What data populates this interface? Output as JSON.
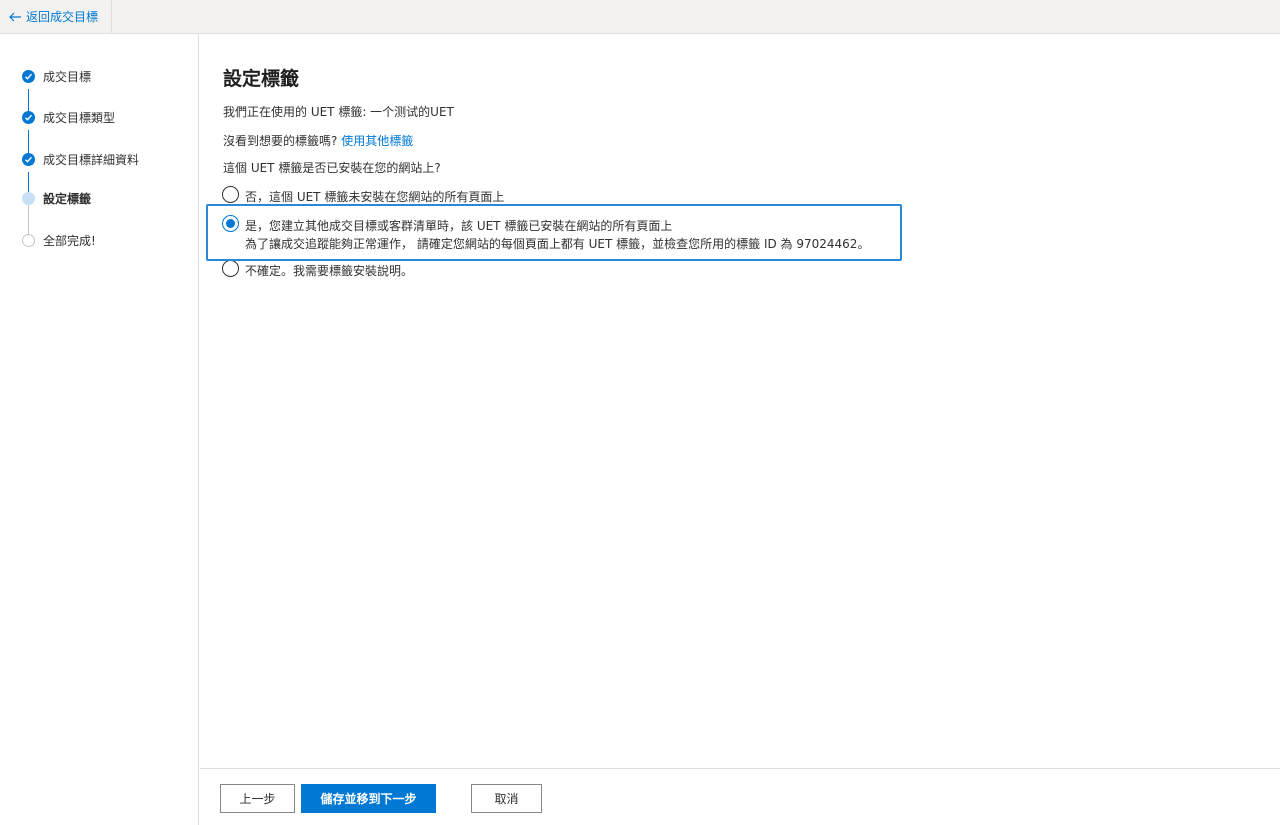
{
  "topbar": {
    "back_label": "返回成交目標"
  },
  "sidebar": {
    "steps": [
      {
        "label": "成交目標",
        "state": "done"
      },
      {
        "label": "成交目標類型",
        "state": "done"
      },
      {
        "label": "成交目標詳細資料",
        "state": "done"
      },
      {
        "label": "設定標籤",
        "state": "current"
      },
      {
        "label": "全部完成!",
        "state": "pending"
      }
    ]
  },
  "main": {
    "title": "設定標籤",
    "using_tag_text": "我們正在使用的 UET 標籤: 一个测试的UET",
    "not_found_text": "沒看到想要的標籤嗎? ",
    "use_other_tag_link": "使用其他標籤",
    "question": "這個 UET 標籤是否已安裝在您的網站上?",
    "options": [
      {
        "label": "否，這個 UET 標籤未安裝在您網站的所有頁面上",
        "selected": false
      },
      {
        "label": "是，您建立其他成交目標或客群清單時，該 UET 標籤已安裝在網站的所有頁面上",
        "sublabel": "為了讓成交追蹤能夠正常運作， 請確定您網站的每個頁面上都有 UET 標籤，並檢查您所用的標籤 ID 為 97024462。",
        "selected": true
      },
      {
        "label": "不確定。我需要標籤安裝說明。",
        "selected": false
      }
    ]
  },
  "footer": {
    "back_button": "上一步",
    "save_next_button": "儲存並移到下一步",
    "cancel_button": "取消"
  },
  "colors": {
    "accent": "#0078d4",
    "highlight_border": "#2b88d8"
  }
}
